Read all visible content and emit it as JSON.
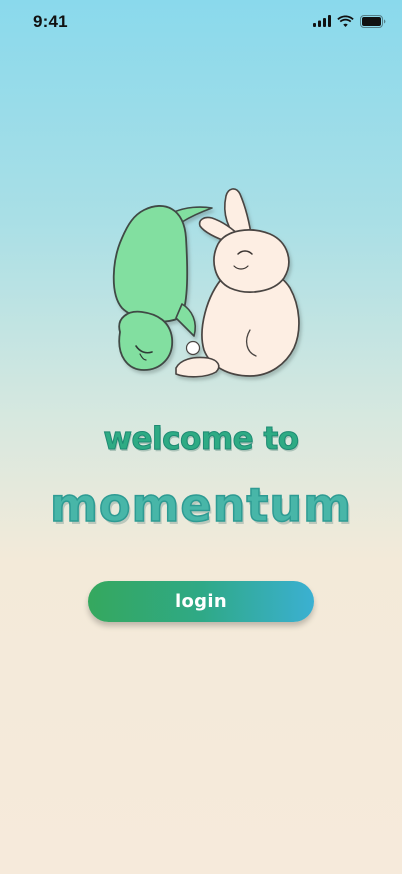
{
  "status_bar": {
    "time": "9:41",
    "icons": [
      "cellular-signal-icon",
      "wifi-icon",
      "battery-icon"
    ]
  },
  "illustration": {
    "characters": [
      "turtle",
      "bunny"
    ]
  },
  "welcome": {
    "line1": "welcome to",
    "brand": "momentum"
  },
  "login_button": {
    "label": "login"
  },
  "colors": {
    "gradient_top": "#8ad9ec",
    "gradient_bottom": "#f6eadb",
    "welcome_text": "#2eab84",
    "brand_text": "#48b6a8",
    "button_start": "#35a85e",
    "button_end": "#3bb0d2",
    "turtle": "#82dfa0",
    "bunny": "#fdeee3"
  }
}
